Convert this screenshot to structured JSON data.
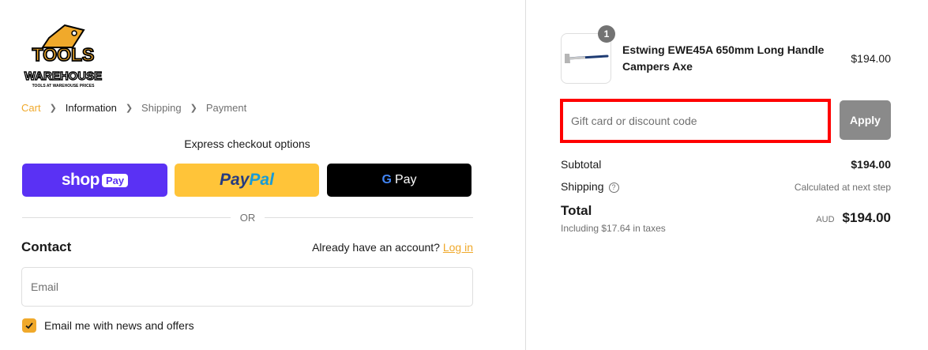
{
  "brand": {
    "logo_line1": "TOOLS",
    "logo_line2": "WAREHOUSE",
    "logo_tagline": "TOOLS AT WAREHOUSE PRICES",
    "accent": "#f0a92b"
  },
  "breadcrumb": [
    {
      "label": "Cart"
    },
    {
      "label": "Information"
    },
    {
      "label": "Shipping"
    },
    {
      "label": "Payment"
    }
  ],
  "express": {
    "title": "Express checkout options",
    "shop_pay": {
      "word": "shop",
      "badge": "Pay",
      "color": "#5a31f4"
    },
    "paypal": {
      "part1": "Pay",
      "part2": "Pal",
      "color": "#ffc439"
    },
    "gpay": {
      "g": "G",
      "label": "Pay",
      "color": "#000000"
    },
    "or_label": "OR"
  },
  "contact": {
    "title": "Contact",
    "account_prompt": "Already have an account?",
    "login_label": "Log in",
    "email_placeholder": "Email",
    "newsletter_label": "Email me with news and offers",
    "newsletter_checked": true
  },
  "cart": {
    "item": {
      "name": "Estwing EWE45A 650mm Long Handle Campers Axe",
      "price": "$194.00",
      "quantity": "1"
    },
    "discount_placeholder": "Gift card or discount code",
    "apply_label": "Apply",
    "subtotal_label": "Subtotal",
    "subtotal_value": "$194.00",
    "shipping_label": "Shipping",
    "shipping_value": "Calculated at next step",
    "total_label": "Total",
    "tax_note": "Including $17.64 in taxes",
    "currency": "AUD",
    "total_value": "$194.00"
  }
}
